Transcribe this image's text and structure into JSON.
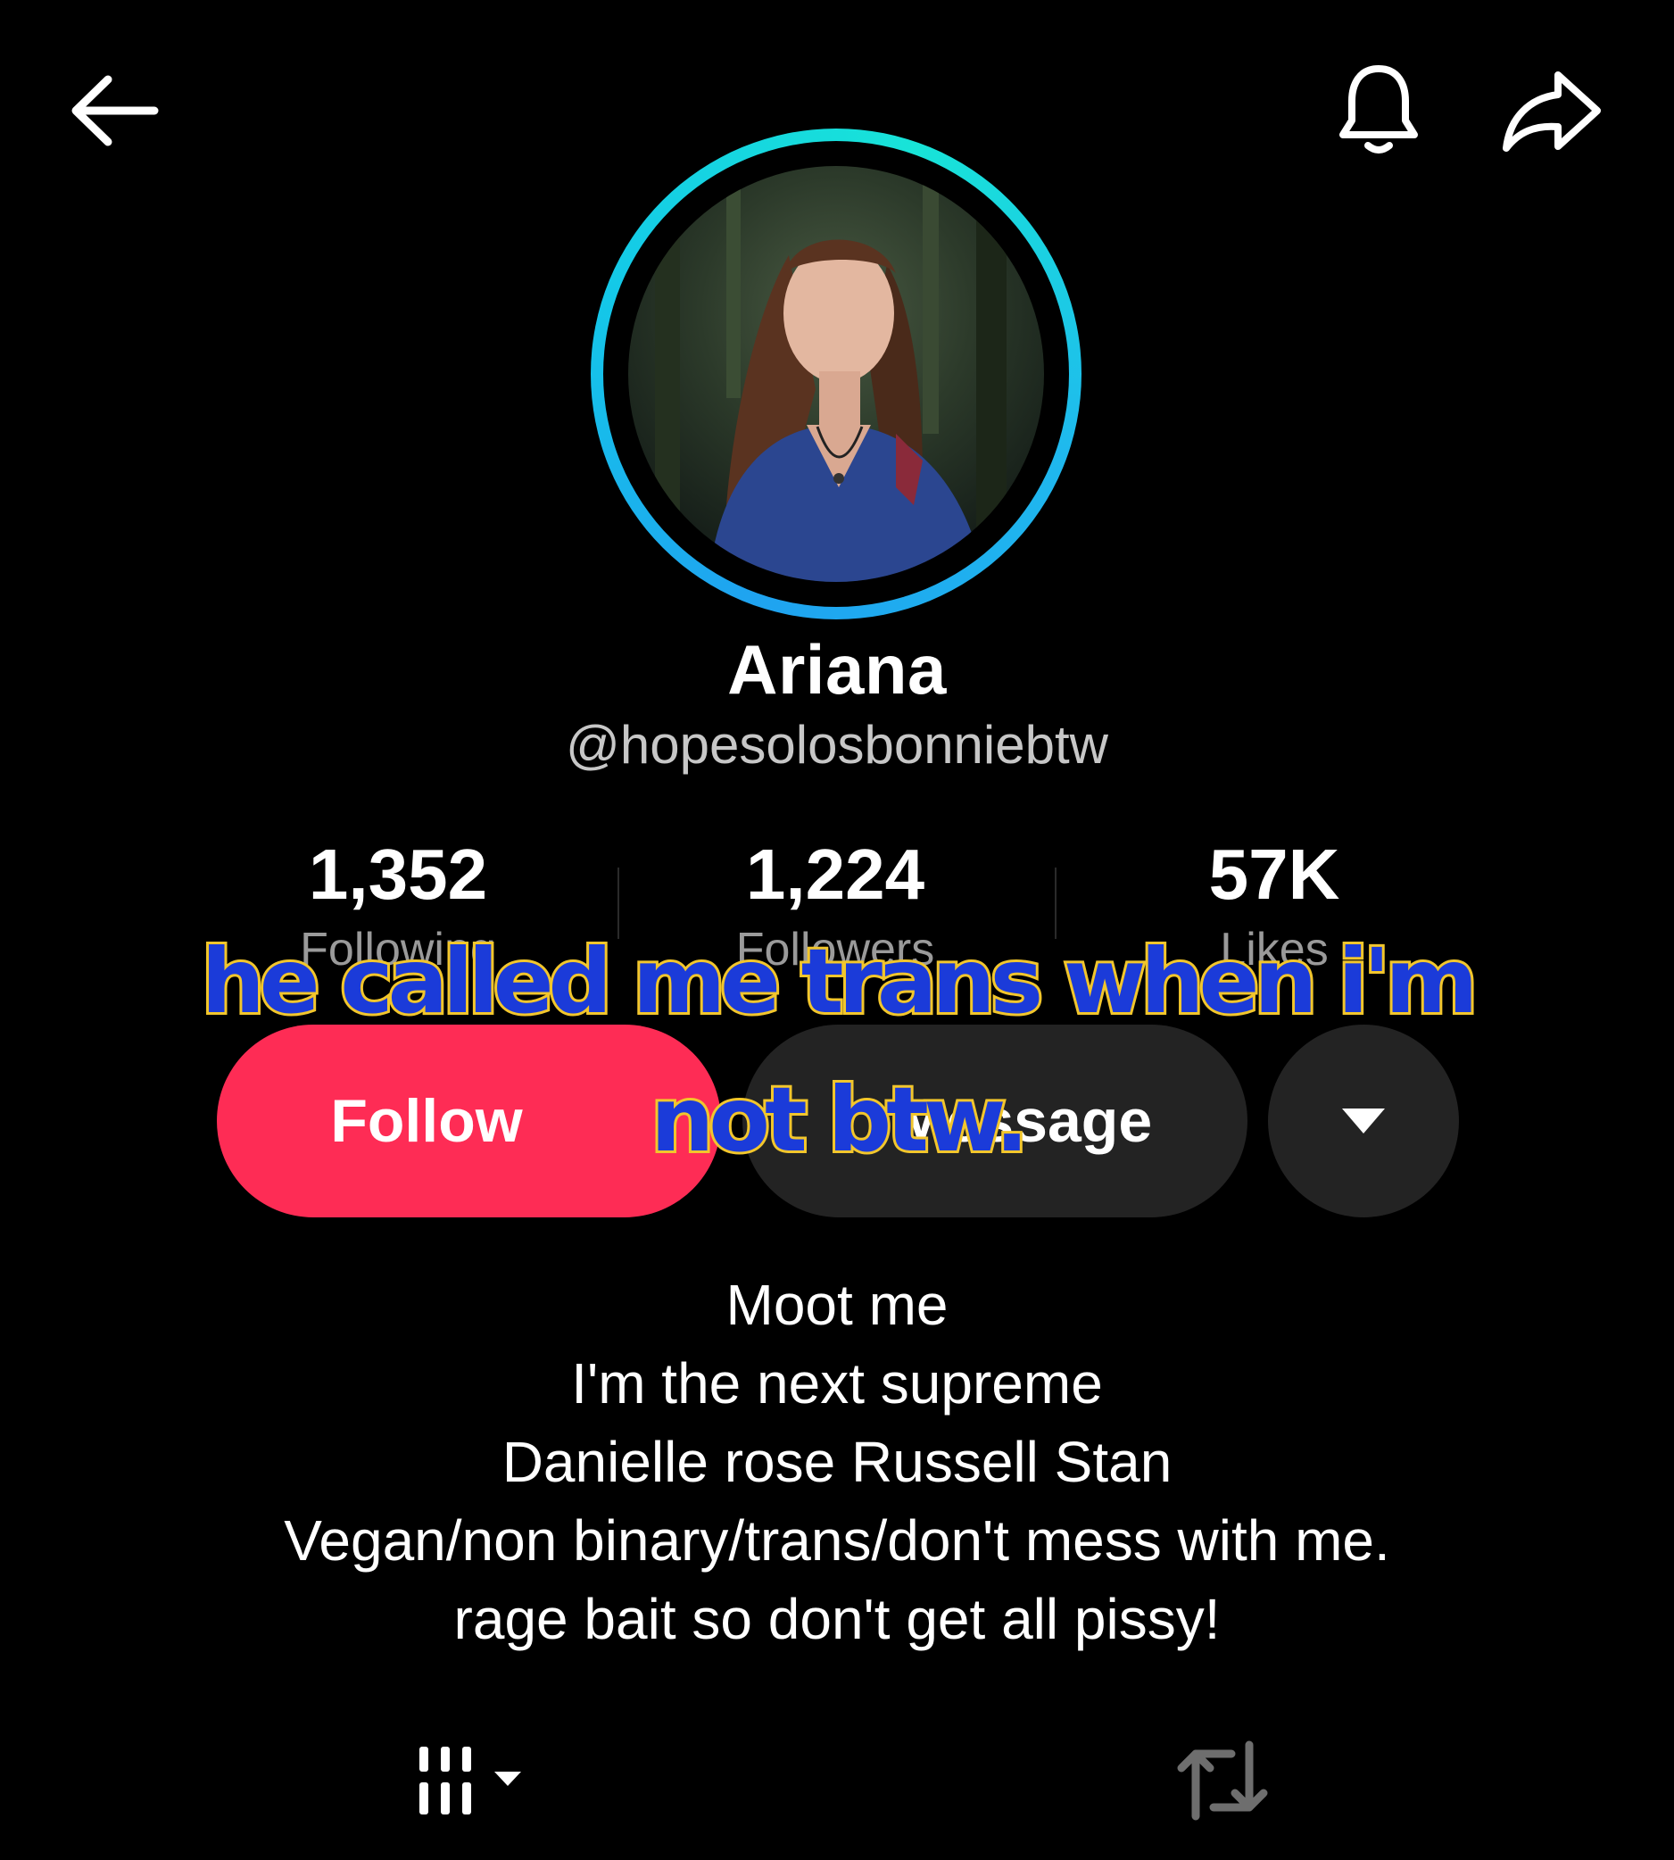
{
  "header": {
    "back_icon": "arrow-left-icon",
    "bell_icon": "bell-icon",
    "share_icon": "share-arrow-icon"
  },
  "profile": {
    "display_name": "Ariana",
    "username": "@hopesolosbonniebtw",
    "avatar_ring_color": "#14c8e8"
  },
  "stats": [
    {
      "value": "1,352",
      "label": "Following"
    },
    {
      "value": "1,224",
      "label": "Followers"
    },
    {
      "value": "57K",
      "label": "Likes"
    }
  ],
  "actions": {
    "follow_label": "Follow",
    "message_label": "Message",
    "more_icon": "caret-down-icon",
    "follow_color": "#fe2c55"
  },
  "overlay_caption": {
    "line1": "he called me trans when i'm",
    "line2": "not btw."
  },
  "bio": {
    "lines": [
      "Moot me",
      "I'm the next supreme",
      "Danielle rose Russell Stan",
      "Vegan/non binary/trans/don't mess with me.",
      "rage bait so don't get all pissy!"
    ]
  },
  "tabs": [
    {
      "icon": "videos-grid-icon"
    },
    {
      "icon": "repost-icon"
    }
  ]
}
